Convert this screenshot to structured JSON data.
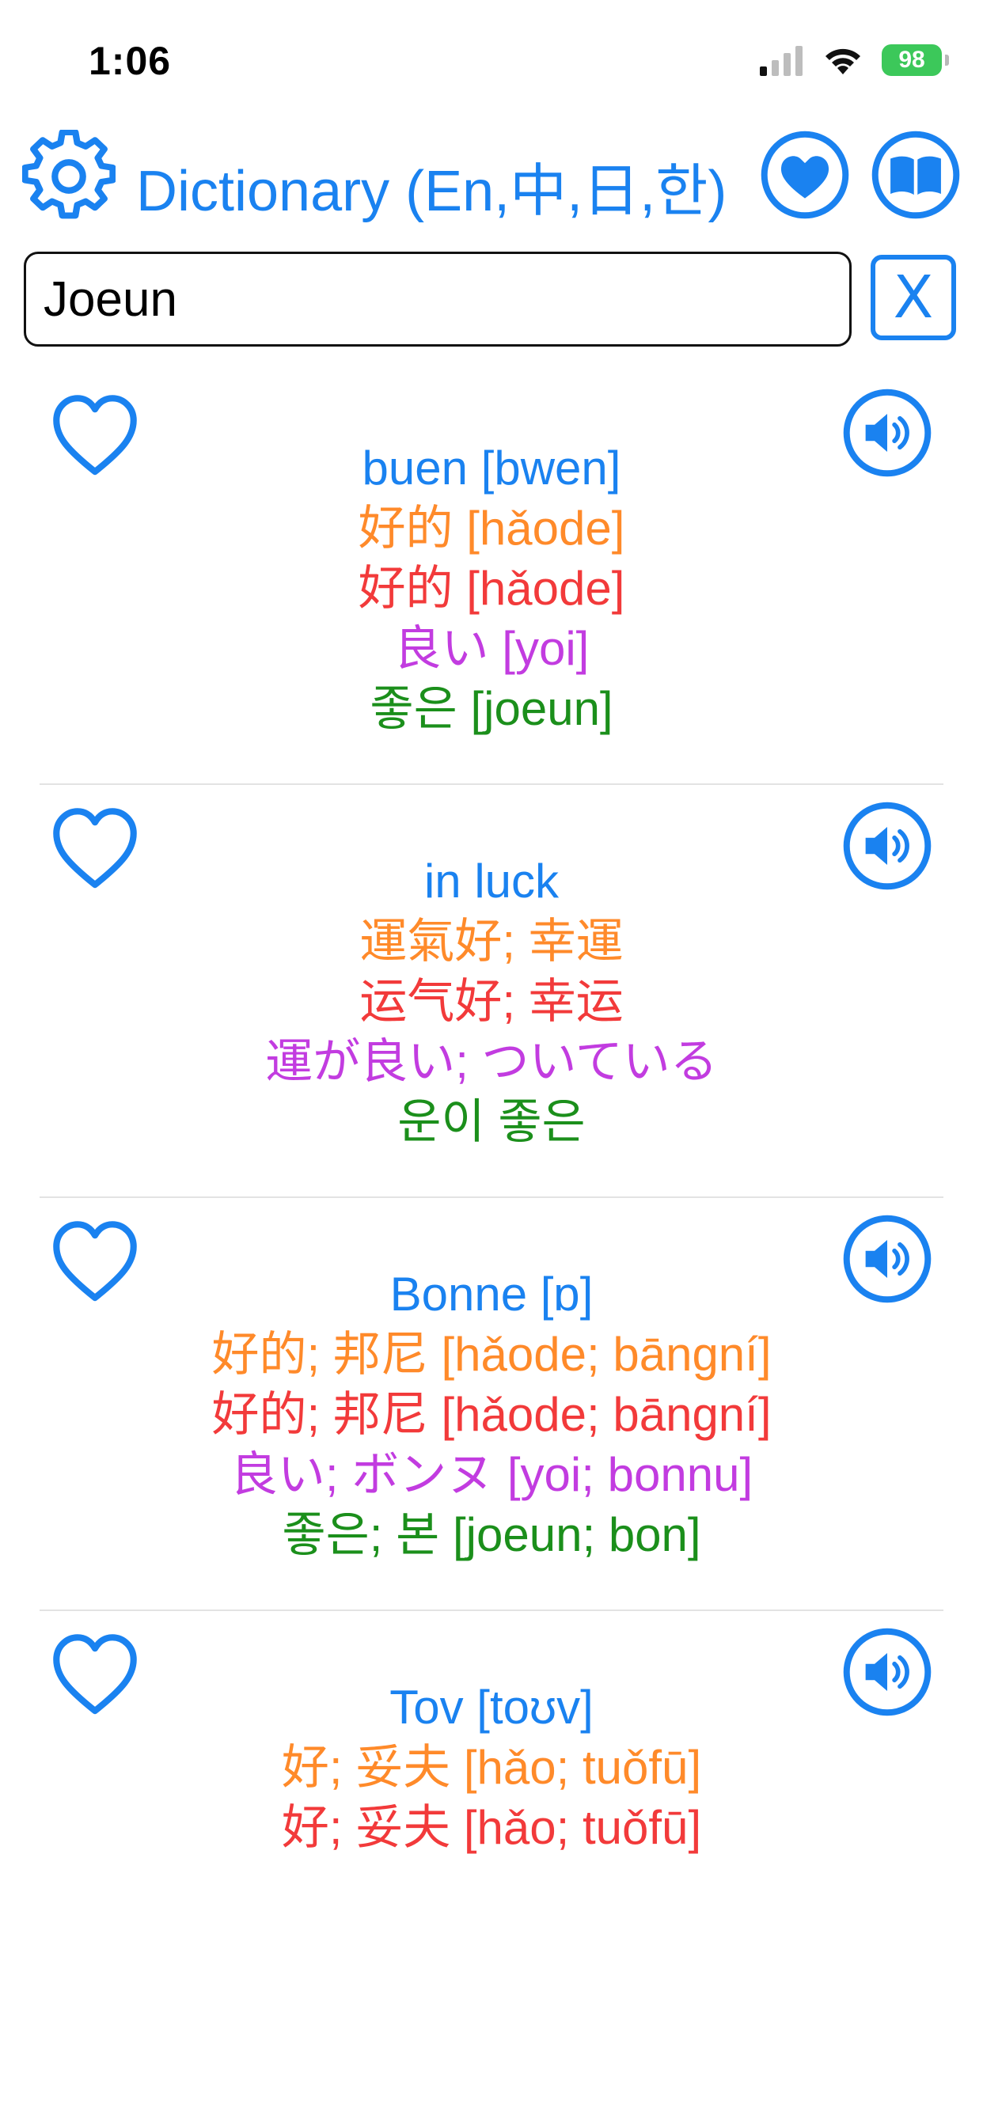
{
  "status_bar": {
    "time": "1:06",
    "battery": "98"
  },
  "header": {
    "title": "Dictionary (En,中,日,한)"
  },
  "search": {
    "value": "Joeun",
    "clear_label": "X"
  },
  "colors": {
    "accent": "#1a82f0",
    "english": "#1a82f0",
    "chinese_traditional": "#ff8a2a",
    "chinese_simplified": "#f23a3a",
    "japanese": "#c23ce0",
    "korean": "#1b8f1b"
  },
  "icons": {
    "settings": "gear-icon",
    "favorites": "heart-filled-icon",
    "dictionary": "book-icon",
    "favorite_toggle": "heart-outline-icon",
    "pronounce": "speaker-icon"
  },
  "entries": [
    {
      "english": "buen  [bwen]",
      "chinese_traditional": "好的  [hǎode]",
      "chinese_simplified": "好的  [hǎode]",
      "japanese": "良い  [yoi]",
      "korean": "좋은  [joeun]"
    },
    {
      "english": "in luck",
      "chinese_traditional": "運氣好; 幸運",
      "chinese_simplified": "运气好; 幸运",
      "japanese": "運が良い; ついている",
      "korean": "운이 좋은"
    },
    {
      "english": "Bonne  [ɒ]",
      "chinese_traditional": "好的; 邦尼  [hǎode; bāngní]",
      "chinese_simplified": "好的; 邦尼  [hǎode; bāngní]",
      "japanese": "良い; ボンヌ  [yoi; bonnu]",
      "korean": "좋은; 본  [joeun; bon]"
    },
    {
      "english": "Tov  [toʊv]",
      "chinese_traditional": "好; 妥夫  [hǎo; tuǒfū]",
      "chinese_simplified": "好; 妥夫  [hǎo; tuǒfū]"
    }
  ]
}
